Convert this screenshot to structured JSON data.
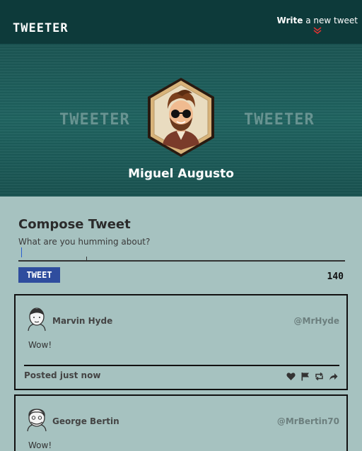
{
  "nav": {
    "brand": "TWEETER",
    "write_bold": "Write",
    "write_rest": " a new tweet",
    "write_icon": "chevron-down-icon"
  },
  "profile": {
    "banner_text_left": "TWEETER",
    "banner_text_right": "TWEETER",
    "name": "Miguel Augusto"
  },
  "compose": {
    "title": "Compose Tweet",
    "placeholder": "What are you humming about?",
    "value": "",
    "button_label": "TWEET",
    "counter": "140"
  },
  "tweets": [
    {
      "name": "Marvin Hyde",
      "handle": "@MrHyde",
      "text": "Wow!",
      "time": "Posted just now",
      "actions": [
        "heart-icon",
        "flag-icon",
        "retweet-icon",
        "share-icon"
      ]
    },
    {
      "name": "George Bertin",
      "handle": "@MrBertin70",
      "text": "Wow!"
    }
  ],
  "colors": {
    "nav_bg": "#0d3a3a",
    "banner": "#1f6360",
    "page_bg": "#a6c2c0",
    "button": "#2f4d9e",
    "accent_red": "#dd3333"
  }
}
